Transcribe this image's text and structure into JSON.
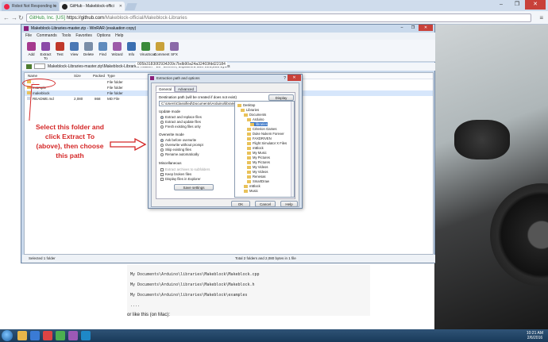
{
  "browser": {
    "tabs": [
      {
        "label": "Robot Not Responding to",
        "active": false
      },
      {
        "label": "GitHub - Makeblock-offici",
        "active": true
      }
    ],
    "url_secure": "GitHub, Inc. [US]",
    "url_host": "https://github.com",
    "url_path": "/Makeblock-official/Makeblock-Libraries"
  },
  "winrar": {
    "title": "Makeblock-Libraries-master.zip - WinRAR (evaluation copy)",
    "menu": [
      "File",
      "Commands",
      "Tools",
      "Favorites",
      "Options",
      "Help"
    ],
    "toolbar": [
      "Add",
      "Extract To",
      "Test",
      "View",
      "Delete",
      "Find",
      "Wizard",
      "Info",
      "VirusScan",
      "Comment",
      "SFX"
    ],
    "path": "Makeblock-Libraries-master.zip\\Makeblock-Libraries-master - ZIP archive, unpacked size 221,938 bytes",
    "columns": [
      "Name",
      "Size",
      "Packed",
      "Type"
    ],
    "rows": [
      {
        "name": "..",
        "size": "",
        "packed": "",
        "type": "File folder"
      },
      {
        "name": "example",
        "size": "",
        "packed": "",
        "type": "File folder"
      },
      {
        "name": "makeblock",
        "size": "",
        "packed": "",
        "type": "File folder"
      },
      {
        "name": "README.md",
        "size": "2,080",
        "packed": "868",
        "type": "MD File"
      }
    ],
    "hash": "005b31830f2934209c7bdb90a24a32403fdd22184",
    "status_left": "Selected 1 folder",
    "status_right": "Total 2 folders and 2,080 bytes in 1 file"
  },
  "annotation": {
    "text": "Select this folder and click Extract To (above), then choose this path"
  },
  "dialog": {
    "title": "Extraction path and options",
    "help": "?",
    "tabs": [
      "General",
      "Advanced"
    ],
    "dest_label": "Destination path (will be created if does not exist)",
    "dest_value": "C:\\Users\\Classified\\Documents\\Arduino\\libraries",
    "display_btn": "Display",
    "newfolder_btn": "New folder",
    "update_mode_label": "Update mode",
    "update_options": [
      "Extract and replace files",
      "Extract and update files",
      "Fresh existing files only"
    ],
    "overwrite_label": "Overwrite mode",
    "overwrite_options": [
      "Ask before overwrite",
      "Overwrite without prompt",
      "Skip existing files",
      "Rename automatically"
    ],
    "misc_label": "Miscellaneous",
    "misc_options": [
      "Extract archives to subfolders",
      "Keep broken files",
      "Display files in Explorer"
    ],
    "save_btn": "Save settings",
    "tree": [
      "Desktop",
      "Libraries",
      "Documents",
      "Arduino",
      "libraries",
      "Criterion Games",
      "Duke Nukem Forever",
      "FAXDRIVEN",
      "Flight Simulator X Files",
      "mBlock",
      "My Music",
      "My Pictures",
      "My Pictures",
      "My Videos",
      "My Videos",
      "Renesas",
      "SmartDraw",
      "mBlock",
      "Music"
    ],
    "ok_btn": "OK",
    "cancel_btn": "Cancel",
    "help_btn": "Help"
  },
  "page": {
    "code_lines": [
      "My Documents\\Arduino\\libraries\\Makeblock\\Makeblock.cpp",
      "My Documents\\Arduino\\libraries\\Makeblock\\Makeblock.h",
      "My Documents\\Arduino\\libraries\\Makeblock\\examples",
      "...."
    ],
    "mac_text": "or like this (on Mac):"
  },
  "taskbar": {
    "time": "10:21 AM",
    "date": "2/6/2016"
  }
}
